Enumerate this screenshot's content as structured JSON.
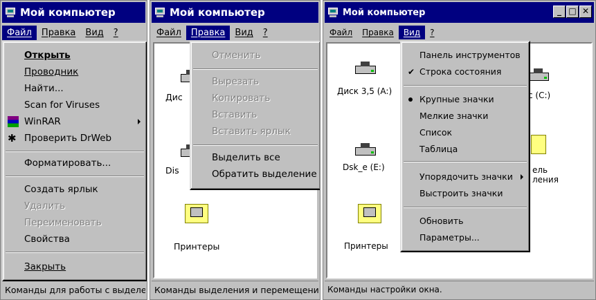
{
  "windows": [
    {
      "title": "Мой компьютер",
      "menu": [
        "Файл",
        "Правка",
        "Вид",
        "?"
      ],
      "status": "Команды для работы с выделенными объектами",
      "file_menu": {
        "open": "Открыть",
        "explorer": "Проводник",
        "find": "Найти...",
        "scan": "Scan for Viruses",
        "winrar": "WinRAR",
        "drweb": "Проверить DrWeb",
        "format": "Форматировать...",
        "shortcut": "Создать ярлык",
        "delete": "Удалить",
        "rename": "Переименовать",
        "properties": "Свойства",
        "close": "Закрыть"
      }
    },
    {
      "title": "Мой компьютер",
      "menu": [
        "Файл",
        "Правка",
        "Вид",
        "?"
      ],
      "status": "Команды выделения и перемещения",
      "icons": [
        "Дис",
        "Dis",
        "Принтеры"
      ],
      "edit_menu": {
        "undo": "Отменить",
        "cut": "Вырезать",
        "copy": "Копировать",
        "paste": "Вставить",
        "paste_shortcut": "Вставить ярлык",
        "select_all": "Выделить все",
        "invert": "Обратить выделение"
      }
    },
    {
      "title": "Мой компьютер",
      "menu": [
        "Файл",
        "Правка",
        "Вид",
        "?"
      ],
      "status": "Команды настройки окна.",
      "icons": [
        "Диск 3,5 (A:)",
        "Dsk_e (E:)",
        "Принтеры",
        "c (C:)",
        "ель",
        "ления"
      ],
      "view_menu": {
        "toolbar": "Панель инструментов",
        "statusbar": "Строка состояния",
        "large": "Крупные значки",
        "small": "Мелкие значки",
        "list": "Список",
        "table": "Таблица",
        "arrange": "Упорядочить значки",
        "line_up": "Выстроить значки",
        "refresh": "Обновить",
        "options": "Параметры..."
      }
    }
  ],
  "colors": {
    "title_bg": "#000080",
    "face": "#c0c0c0",
    "highlight": "#000080"
  }
}
